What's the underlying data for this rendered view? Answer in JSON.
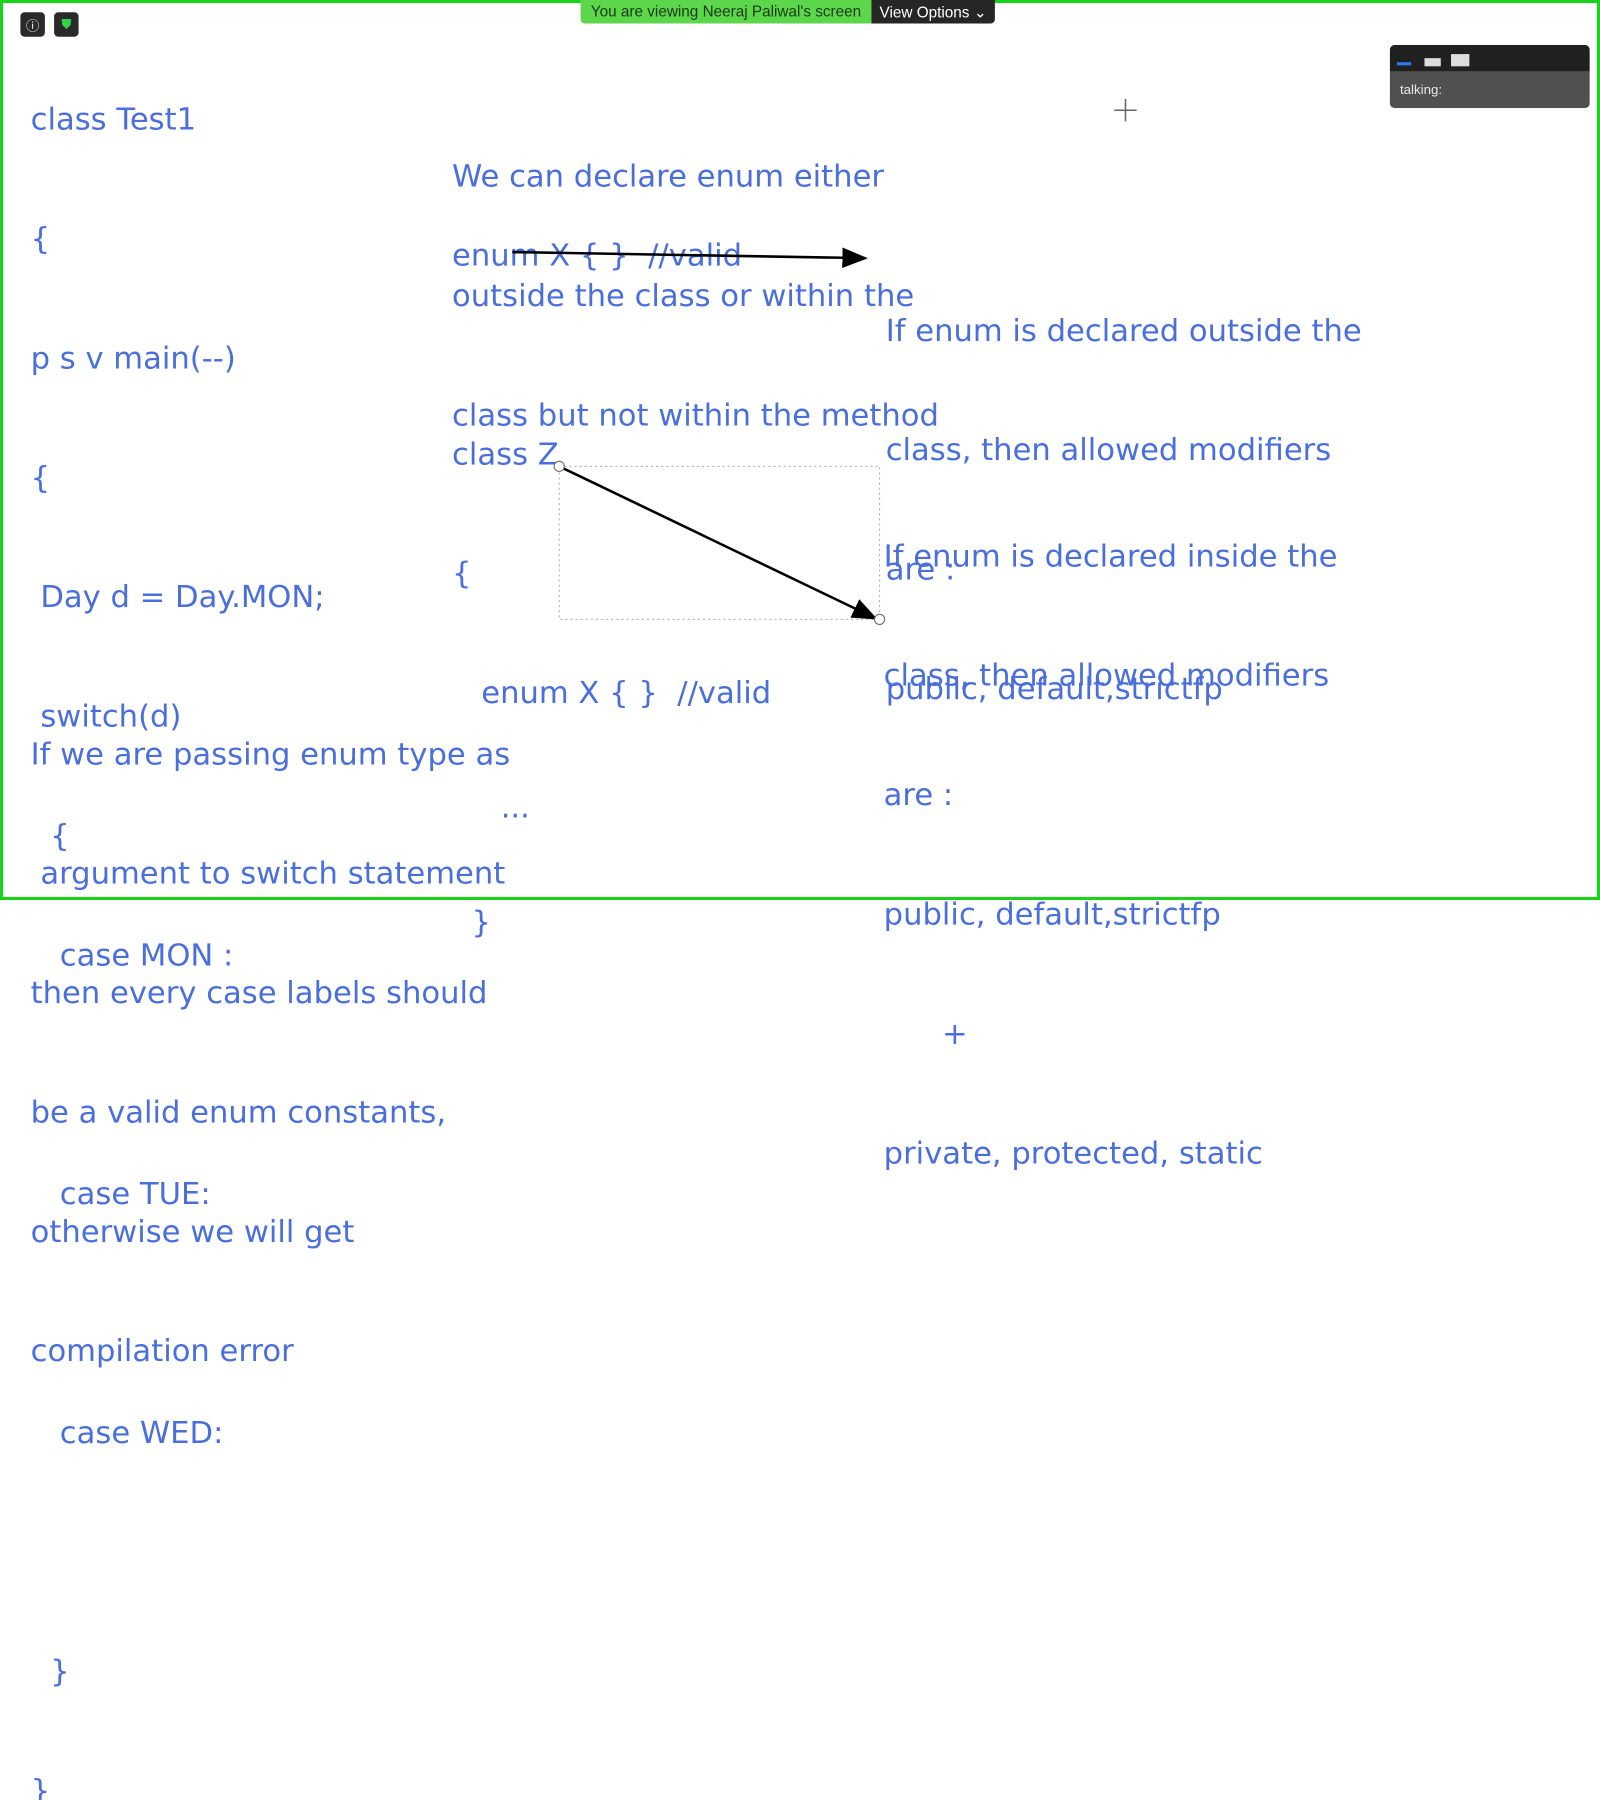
{
  "banner": {
    "viewing": "You are viewing Neeraj Paliwal's screen",
    "view_options": "View Options"
  },
  "panel": {
    "talking": "talking:"
  },
  "code": [
    "class Test1",
    "{",
    "p s v main(--)",
    "{",
    " Day d = Day.MON;",
    " switch(d)",
    "  {",
    "   case MON :",
    "",
    "   case TUE:",
    "",
    "   case WED:",
    "",
    "  }",
    "}"
  ],
  "note_switch": [
    "If we are passing enum type as",
    " argument to switch statement",
    "then every case labels should",
    "be a valid enum constants,",
    "otherwise we will get",
    "compilation error"
  ],
  "note_declare": [
    "We can declare enum either",
    "outside the class or within the",
    "class but not within the method"
  ],
  "enum_outside": "enum X { }  //valid",
  "class_z": [
    "class Z",
    "{",
    "   enum X { }  //valid",
    "     ...",
    "  }"
  ],
  "outside_rule": [
    "If enum is declared outside the",
    "class, then allowed modifiers",
    "are :",
    "public, default,strictfp"
  ],
  "inside_rule": [
    "If enum is declared inside the",
    "class, then allowed modifiers",
    "are :",
    "public, default,strictfp",
    "      +",
    "private, protected, static"
  ],
  "colors": {
    "text": "#4a6fdc",
    "border": "#19d219",
    "banner": "#5cd64a"
  }
}
